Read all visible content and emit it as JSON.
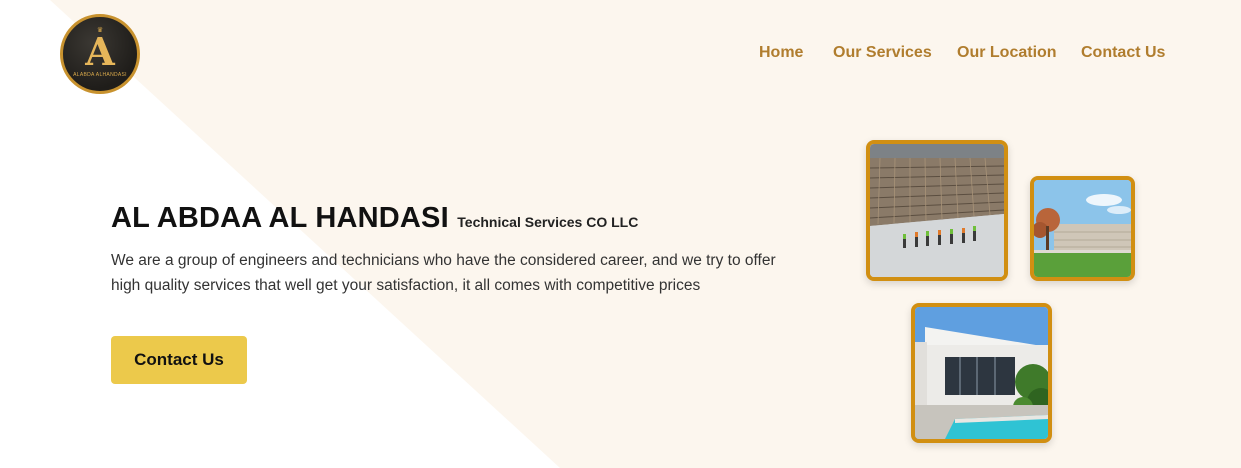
{
  "logo": {
    "letter": "A",
    "subtitle": "ALABDA ALHANDASI"
  },
  "nav": {
    "items": [
      {
        "label": "Home"
      },
      {
        "label": "Our Services"
      },
      {
        "label": "Our Location"
      },
      {
        "label": "Contact Us"
      }
    ]
  },
  "hero": {
    "title": "AL ABDAA AL HANDASI",
    "subtitle": "Technical Services CO LLC",
    "description": "We are a group of engineers and technicians who have the considered career, and we try to offer high quality services that well get your satisfaction, it all comes with competitive prices",
    "cta_label": "Contact Us"
  },
  "colors": {
    "accent": "#b07d2e",
    "button": "#ecc94b",
    "photo_border": "#d18f12",
    "background": "#fcf6ee"
  }
}
